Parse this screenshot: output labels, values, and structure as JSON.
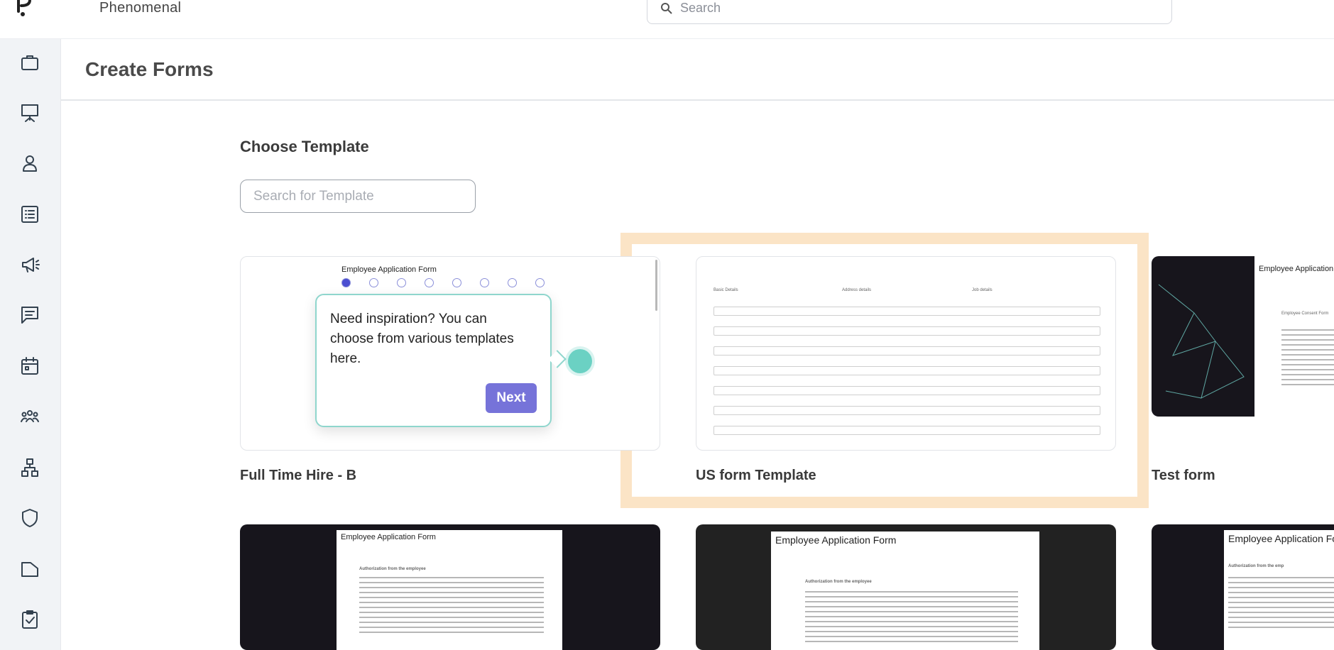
{
  "app": {
    "brand": "Phenomenal"
  },
  "search": {
    "placeholder": "Search"
  },
  "sidebar": {
    "items": [
      {
        "icon": "briefcase-icon"
      },
      {
        "icon": "presentation-icon"
      },
      {
        "icon": "person-icon"
      },
      {
        "icon": "list-icon"
      },
      {
        "icon": "megaphone-icon"
      },
      {
        "icon": "chat-icon"
      },
      {
        "icon": "calendar-icon"
      },
      {
        "icon": "team-icon"
      },
      {
        "icon": "org-chart-icon"
      },
      {
        "icon": "shield-icon"
      },
      {
        "icon": "folder-icon"
      },
      {
        "icon": "clipboard-check-icon"
      }
    ]
  },
  "page": {
    "title": "Create Forms"
  },
  "templates": {
    "heading": "Choose Template",
    "search_placeholder": "Search for Template",
    "cards": [
      {
        "label": "Full Time Hire - B",
        "preview_title": "Employee Application Form"
      },
      {
        "label": "US form Template",
        "preview_steps": [
          "Basic Details",
          "Address details",
          "Job details"
        ]
      },
      {
        "label": "Test form",
        "preview_title": "Employee Application",
        "preview_subtitle": "Employee Consent Form"
      },
      {
        "label": "",
        "preview_title": "Employee Application Form",
        "preview_subtitle": "Authorization from the employee"
      },
      {
        "label": "",
        "preview_title": "Employee Application Form",
        "preview_subtitle": "Authorization from the employee"
      },
      {
        "label": "",
        "preview_title": "Employee Application Fo",
        "preview_subtitle": "Authorization from the emp"
      }
    ]
  },
  "tour": {
    "message": "Need inspiration? You can choose from various templates here.",
    "next_label": "Next"
  },
  "colors": {
    "accent": "#7673d9",
    "highlight": "#fbe4c6",
    "beacon": "#6bd1c3"
  }
}
